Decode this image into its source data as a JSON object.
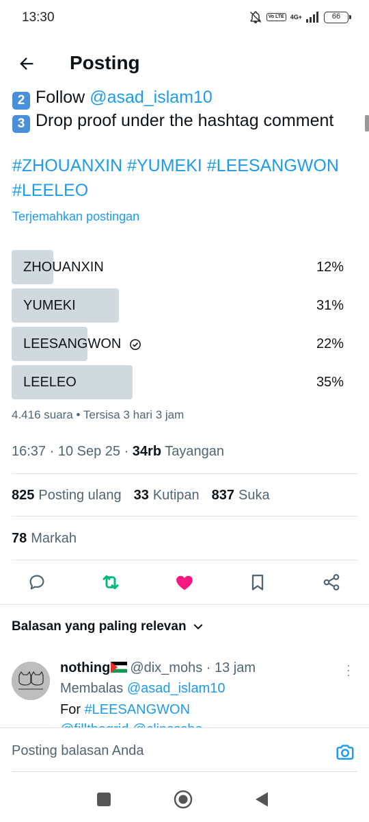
{
  "status_bar": {
    "time": "13:30",
    "volte": "Vo LTE",
    "network": "4G+",
    "battery": "66"
  },
  "header": {
    "title": "Posting"
  },
  "tweet": {
    "line2_key": "2",
    "line2_text": "Follow ",
    "line2_mention": "@asad_islam10",
    "line3_key": "3",
    "line3_text": "Drop proof under the hashtag comment",
    "hashtags": "#ZHOUANXIN #YUMEKI  #LEESANGWON #LEELEO",
    "translate": "Terjemahkan postingan"
  },
  "poll": {
    "options": [
      {
        "label": "ZHOUANXIN",
        "percent": "12%",
        "fraction": 0.12,
        "selected": false
      },
      {
        "label": "YUMEKI",
        "percent": "31%",
        "fraction": 0.31,
        "selected": false
      },
      {
        "label": "LEESANGWON",
        "percent": "22%",
        "fraction": 0.22,
        "selected": true
      },
      {
        "label": "LEELEO",
        "percent": "35%",
        "fraction": 0.35,
        "selected": false
      }
    ],
    "meta": "4.416 suara • Tersisa 3 hari 3 jam"
  },
  "meta": {
    "time_date": "16:37 · 10 Sep 25 · ",
    "views_count": "34rb",
    "views_label": "Tayangan"
  },
  "stats": {
    "reposts_count": "825",
    "reposts_label": "Posting ulang",
    "quotes_count": "33",
    "quotes_label": "Kutipan",
    "likes_count": "837",
    "likes_label": "Suka",
    "bookmarks_count": "78",
    "bookmarks_label": "Markah"
  },
  "colors": {
    "accent": "#1d9bf0",
    "retweet": "#00ba7c",
    "like": "#f91880",
    "poll_bar": "#cfd9de"
  },
  "replies": {
    "filter_label": "Balasan yang paling relevan",
    "item": {
      "name": "nothing",
      "handle_time": "@dix_mohs · 13 jam",
      "reply_to_prefix": "Membalas ",
      "reply_to_handle": "@asad_islam10",
      "text_prefix": "For ",
      "text_hashtag": "#LEESANGWON",
      "text_line2": "@fillthegrid @clipsscho"
    }
  },
  "compose": {
    "placeholder": "Posting balasan Anda"
  }
}
